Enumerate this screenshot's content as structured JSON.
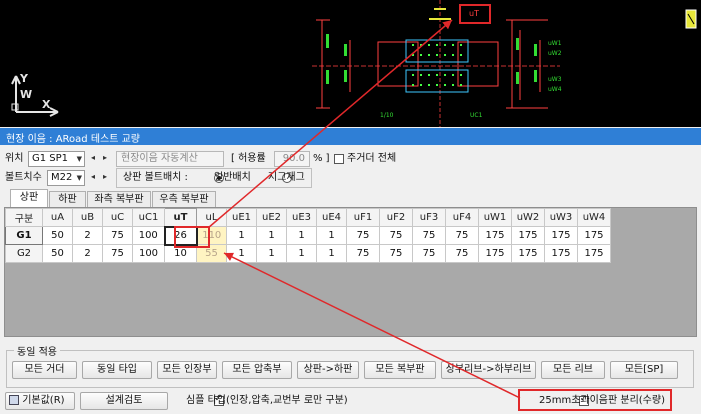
{
  "cad": {
    "uT_label": "uT",
    "ucs_y": "Y",
    "ucs_w": "W",
    "ucs_x": "X",
    "dim_labels": [
      "1/10",
      "UC1",
      "uW1",
      "uW2",
      "uW3",
      "uW4"
    ]
  },
  "panel": {
    "title": "현장 이음 : ARoad 테스트 교량"
  },
  "location": {
    "label": "위치",
    "value": "G1 SP1",
    "auto_calc": "현장이음 자동계산",
    "tolerance_label": "[ 허용률",
    "tolerance_value": "90.0",
    "tolerance_unit": "% ]",
    "main_girder_all": "주거더 전체"
  },
  "bolt": {
    "label": "볼트치수",
    "value": "M22",
    "top_plate_label": "상판 볼트배치 :",
    "opt_general": "일반배치",
    "opt_zigzag": "지그재그"
  },
  "tabs": [
    "상판",
    "하판",
    "좌측 복부판",
    "우측 복부판"
  ],
  "grid": {
    "headers": [
      "구분",
      "uA",
      "uB",
      "uC",
      "uC1",
      "uT",
      "uL",
      "uE1",
      "uE2",
      "uE3",
      "uE4",
      "uF1",
      "uF2",
      "uF3",
      "uF4",
      "uW1",
      "uW2",
      "uW3",
      "uW4"
    ],
    "rows": [
      [
        "G1",
        "50",
        "2",
        "75",
        "100",
        "26",
        "110",
        "1",
        "1",
        "1",
        "1",
        "75",
        "75",
        "75",
        "75",
        "175",
        "175",
        "175",
        "175"
      ],
      [
        "G2",
        "50",
        "2",
        "75",
        "100",
        "10",
        "55",
        "1",
        "1",
        "1",
        "1",
        "75",
        "75",
        "75",
        "75",
        "175",
        "175",
        "175",
        "175"
      ]
    ]
  },
  "same_apply": {
    "title": "동일 적용",
    "buttons": [
      "모든 거더",
      "동일 타입",
      "모든 인장부",
      "모든 압축부",
      "상판->하판",
      "모든 복부판",
      "상부리브->하부리브",
      "모든 리브",
      "모든[SP]"
    ]
  },
  "bottom": {
    "default_button": "기본값(R)",
    "design_check_button": "설계검토",
    "simple_type_label": "심플 타입(인장,압축,교번부 로만 구분)",
    "split_label": "25mm초과이음판 분리(수량)"
  },
  "colors": {
    "accent": "#2f7fd6",
    "highlight": "#e0282a",
    "cad_bg": "#000000"
  }
}
